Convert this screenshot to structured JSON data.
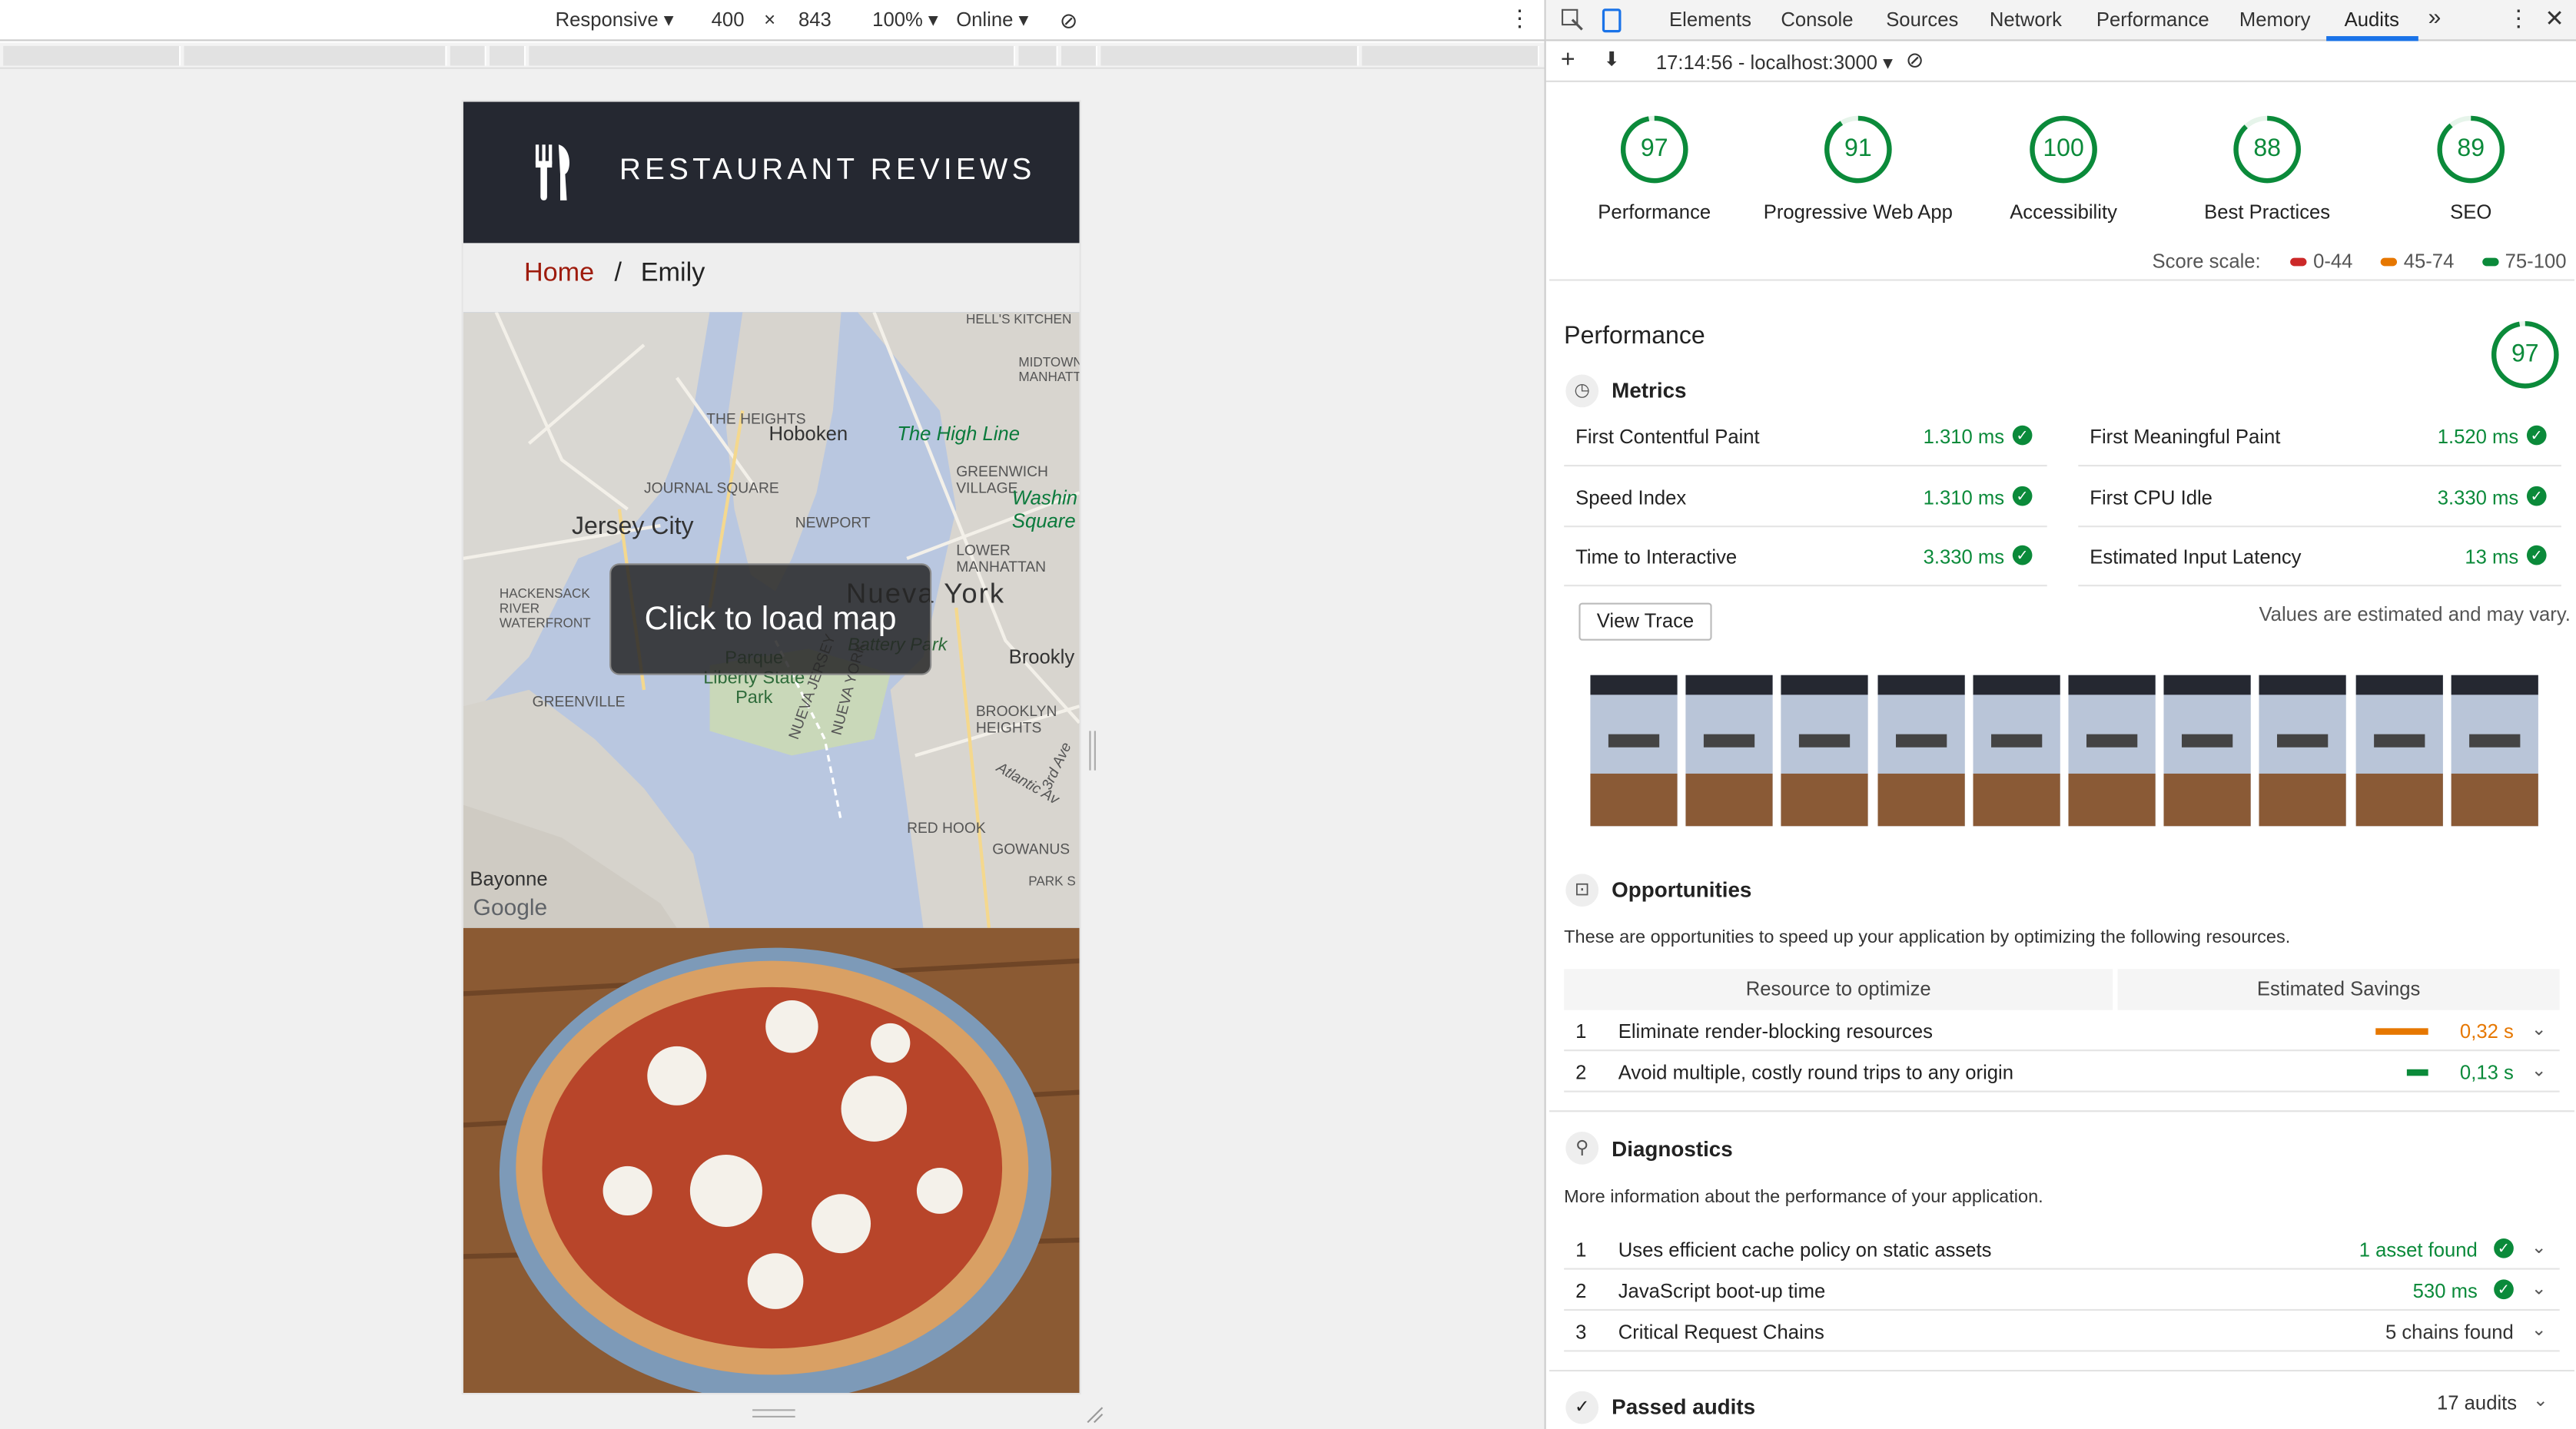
{
  "device_toolbar": {
    "mode": "Responsive",
    "width": "400",
    "x": "×",
    "height": "843",
    "zoom": "100%",
    "network": "Online"
  },
  "site": {
    "title": "RESTAURANT REVIEWS",
    "breadcrumb_home": "Home",
    "breadcrumb_sep": "/",
    "breadcrumb_current": "Emily",
    "map_button": "Click to load map",
    "map_labels": [
      "Hoboken",
      "The High Line",
      "Jersey City",
      "Nueva York",
      "JOURNAL SQUARE",
      "NEWPORT",
      "GREENWICH VILLAGE",
      "LOWER MANHATTAN",
      "THE HEIGHTS",
      "Washin Square",
      "Parque Liberty State Park",
      "Battery Park",
      "Brookly",
      "HACKENSACK RIVER WATERFRONT",
      "GREENVILLE",
      "BROOKLYN HEIGHTS",
      "RED HOOK",
      "GOWANUS",
      "Bayonne",
      "Google",
      "HELL'S KITCHEN",
      "MIDTOWN MANHATTA",
      "PARK S",
      "NUEVA JERSEY",
      "NUEVA YORK",
      "Atlantic Av",
      "3rd Ave"
    ]
  },
  "devtools": {
    "tabs": [
      "Elements",
      "Console",
      "Sources",
      "Network",
      "Performance",
      "Memory",
      "Audits"
    ],
    "active_tab": "Audits",
    "more": "»",
    "report_select": "17:14:56 - localhost:3000",
    "scores": [
      {
        "value": "97",
        "label": "Performance"
      },
      {
        "value": "91",
        "label": "Progressive Web App"
      },
      {
        "value": "100",
        "label": "Accessibility"
      },
      {
        "value": "88",
        "label": "Best Practices"
      },
      {
        "value": "89",
        "label": "SEO"
      }
    ],
    "score_scale_label": "Score scale:",
    "scale": [
      {
        "range": "0-44",
        "color": "#cc2929"
      },
      {
        "range": "45-74",
        "color": "#e67700"
      },
      {
        "range": "75-100",
        "color": "#0b8a3a"
      }
    ],
    "performance": {
      "title": "Performance",
      "score": "97"
    },
    "metrics_title": "Metrics",
    "metrics": [
      {
        "name": "First Contentful Paint",
        "value": "1.310 ms"
      },
      {
        "name": "First Meaningful Paint",
        "value": "1.520 ms"
      },
      {
        "name": "Speed Index",
        "value": "1.310 ms"
      },
      {
        "name": "First CPU Idle",
        "value": "3.330 ms"
      },
      {
        "name": "Time to Interactive",
        "value": "3.330 ms"
      },
      {
        "name": "Estimated Input Latency",
        "value": "13 ms"
      }
    ],
    "view_trace": "View Trace",
    "estimated_note": "Values are estimated and may vary.",
    "opportunities": {
      "title": "Opportunities",
      "desc": "These are opportunities to speed up your application by optimizing the following resources.",
      "col1": "Resource to optimize",
      "col2": "Estimated Savings",
      "rows": [
        {
          "i": "1",
          "name": "Eliminate render-blocking resources",
          "value": "0,32 s",
          "color": "#e67700",
          "bar": 0.32
        },
        {
          "i": "2",
          "name": "Avoid multiple, costly round trips to any origin",
          "value": "0,13 s",
          "color": "#0b8a3a",
          "bar": 0.13
        }
      ]
    },
    "diagnostics": {
      "title": "Diagnostics",
      "desc": "More information about the performance of your application.",
      "rows": [
        {
          "i": "1",
          "name": "Uses efficient cache policy on static assets",
          "value": "1 asset found"
        },
        {
          "i": "2",
          "name": "JavaScript boot-up time",
          "value": "530 ms"
        },
        {
          "i": "3",
          "name": "Critical Request Chains",
          "value": "5 chains found"
        }
      ]
    },
    "passed": {
      "title": "Passed audits",
      "count": "17 audits"
    }
  }
}
